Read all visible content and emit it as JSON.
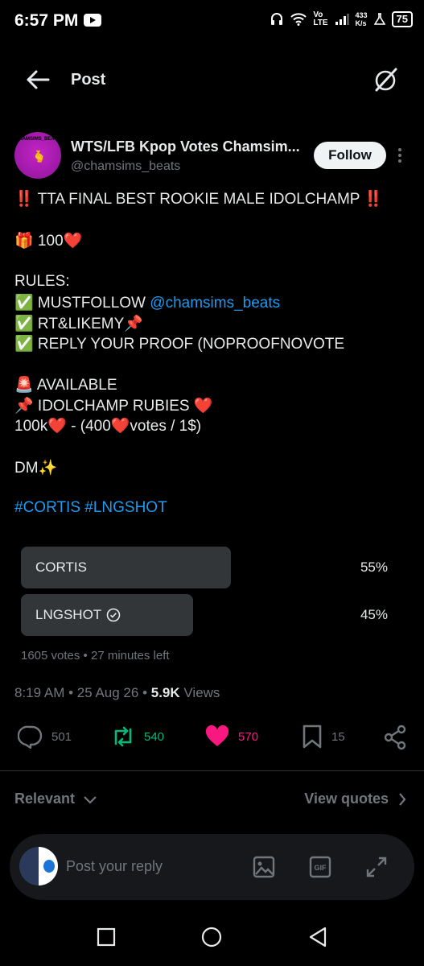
{
  "status_bar": {
    "time": "6:57 PM",
    "network_speed_top": "433",
    "network_speed_bottom": "K/s",
    "volte_top": "Vo",
    "volte_bottom": "LTE",
    "battery": "75"
  },
  "header": {
    "title": "Post"
  },
  "author": {
    "name": "WTS/LFB Kpop Votes Chamsim...",
    "handle": "@chamsims_beats",
    "follow_label": "Follow",
    "avatar_text": "CHAMSIMS_BEATS"
  },
  "post": {
    "line1": "‼️ TTA FINAL BEST ROOKIE MALE IDOLCHAMP ‼️",
    "line2": "🎁 100❤️",
    "line3": "RULES:",
    "line4_prefix": "✅ MUSTFOLLOW ",
    "line4_link": "@chamsims_beats",
    "line5": "✅ RT&LIKEMY📌",
    "line6": "✅ REPLY YOUR PROOF (NOPROOFNOVOTE",
    "line7": "🚨 AVAILABLE",
    "line8": "📌 IDOLCHAMP RUBIES ❤️",
    "line9": "100k❤️ -  (400❤️votes / 1$)",
    "line10": "DM✨",
    "hashtags": "#CORTIS #LNGSHOT"
  },
  "poll": {
    "options": [
      {
        "label": "CORTIS",
        "percent": "55%",
        "share": 0.55
      },
      {
        "label": "LNGSHOT",
        "percent": "45%",
        "share": 0.45
      }
    ],
    "meta": "1605 votes • 27 minutes left"
  },
  "post_meta": {
    "time_date": "8:19 AM • 25 Aug 26 • ",
    "views_count": "5.9K",
    "views_label": " Views"
  },
  "actions": {
    "replies": "501",
    "reposts": "540",
    "likes": "570",
    "bookmarks": "15"
  },
  "colors": {
    "repost": "#00ba7c",
    "like": "#f91880",
    "link": "#1d9bf0",
    "follow_bg": "#eff3f4"
  },
  "filter": {
    "relevant_label": "Relevant",
    "view_quotes_label": "View quotes"
  },
  "reply_bar": {
    "placeholder": "Post your reply"
  }
}
